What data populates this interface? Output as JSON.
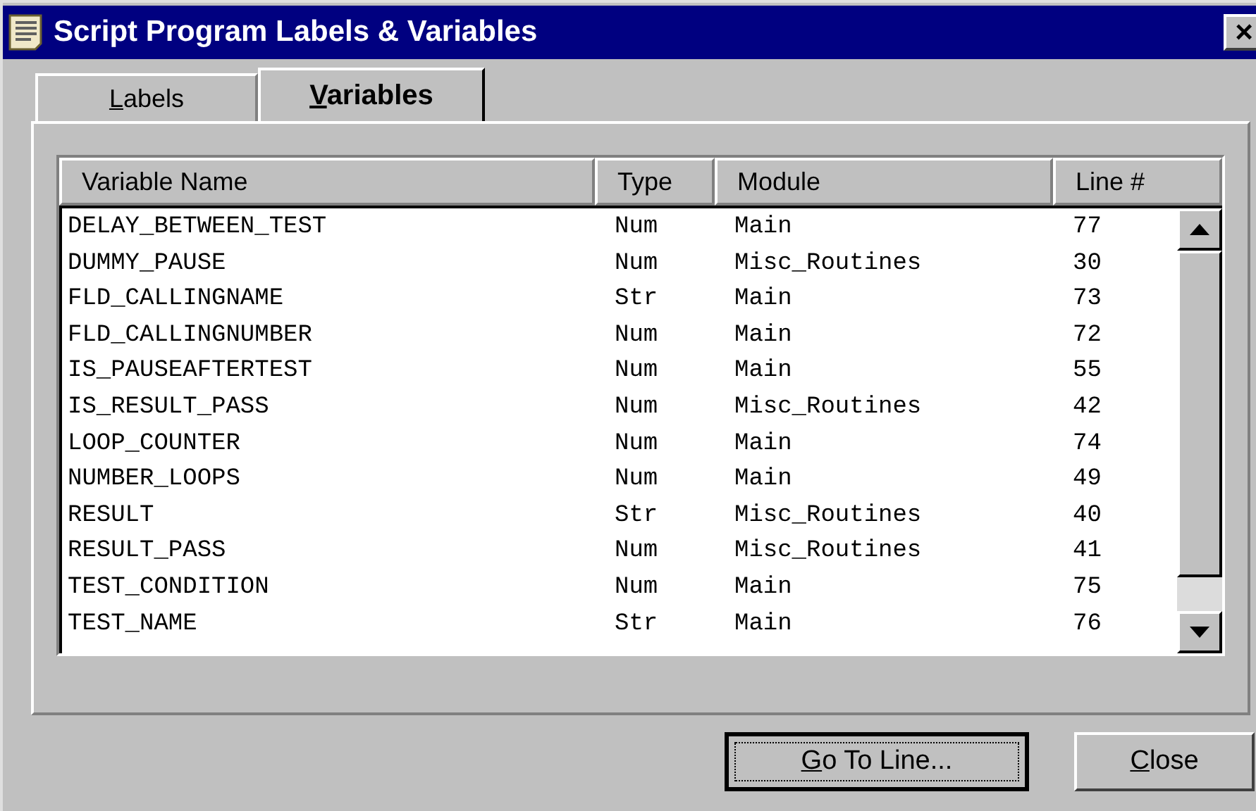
{
  "window": {
    "title": "Script Program Labels & Variables",
    "close": "×"
  },
  "tabs": [
    {
      "accel": "L",
      "rest": "abels",
      "selected": false
    },
    {
      "accel": "V",
      "rest": "ariables",
      "selected": true
    }
  ],
  "table": {
    "columns": [
      "Variable Name",
      "Type",
      "Module",
      "Line #"
    ],
    "rows": [
      [
        "DELAY_BETWEEN_TEST",
        "Num",
        "Main",
        "77"
      ],
      [
        "DUMMY_PAUSE",
        "Num",
        "Misc_Routines",
        "30"
      ],
      [
        "FLD_CALLINGNAME",
        "Str",
        "Main",
        "73"
      ],
      [
        "FLD_CALLINGNUMBER",
        "Num",
        "Main",
        "72"
      ],
      [
        "IS_PAUSEAFTERTEST",
        "Num",
        "Main",
        "55"
      ],
      [
        "IS_RESULT_PASS",
        "Num",
        "Misc_Routines",
        "42"
      ],
      [
        "LOOP_COUNTER",
        "Num",
        "Main",
        "74"
      ],
      [
        "NUMBER_LOOPS",
        "Num",
        "Main",
        "49"
      ],
      [
        "RESULT",
        "Str",
        "Misc_Routines",
        "40"
      ],
      [
        "RESULT_PASS",
        "Num",
        "Misc_Routines",
        "41"
      ],
      [
        "TEST_CONDITION",
        "Num",
        "Main",
        "75"
      ],
      [
        "TEST_NAME",
        "Str",
        "Main",
        "76"
      ]
    ]
  },
  "buttons": [
    {
      "accel": "G",
      "rest": "o To Line...",
      "default": true
    },
    {
      "accel": "C",
      "rest": "lose",
      "default": false
    }
  ]
}
